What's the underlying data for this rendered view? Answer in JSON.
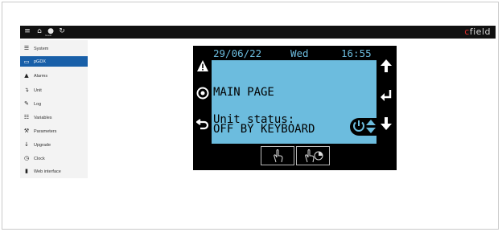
{
  "topbar": {
    "icons": [
      "menu-icon",
      "home-icon",
      "user-icon",
      "refresh-icon"
    ],
    "user_label": "Guest",
    "brand_prefix": "c",
    "brand_rest": "field",
    "brand_color": "#e8322f"
  },
  "sidebar": {
    "active_color": "#185fa8",
    "items": [
      {
        "label": "System",
        "icon": "list-icon"
      },
      {
        "label": "pGDX",
        "icon": "display-icon"
      },
      {
        "label": "Alarms",
        "icon": "bell-icon"
      },
      {
        "label": "Unit",
        "icon": "unit-icon"
      },
      {
        "label": "Log",
        "icon": "log-icon"
      },
      {
        "label": "Variables",
        "icon": "database-icon"
      },
      {
        "label": "Parameters",
        "icon": "wrench-icon"
      },
      {
        "label": "Upgrade",
        "icon": "download-icon"
      },
      {
        "label": "Clock",
        "icon": "clock-icon"
      },
      {
        "label": "Web interface",
        "icon": "bookmark-icon"
      }
    ]
  },
  "pgd": {
    "screen_color": "#6cbcde",
    "date": "29/06/22",
    "day": "Wed",
    "time": "16:55",
    "title": "MAIN PAGE",
    "status_line1": "Unit status:",
    "status_line2": "OFF BY KEYBOARD",
    "left_buttons": [
      "alarm-icon",
      "program-icon",
      "escape-icon"
    ],
    "right_buttons": [
      "up-arrow-icon",
      "enter-icon",
      "down-arrow-icon"
    ],
    "bottom_buttons": [
      "touch-icon",
      "touch-hold-icon"
    ]
  }
}
